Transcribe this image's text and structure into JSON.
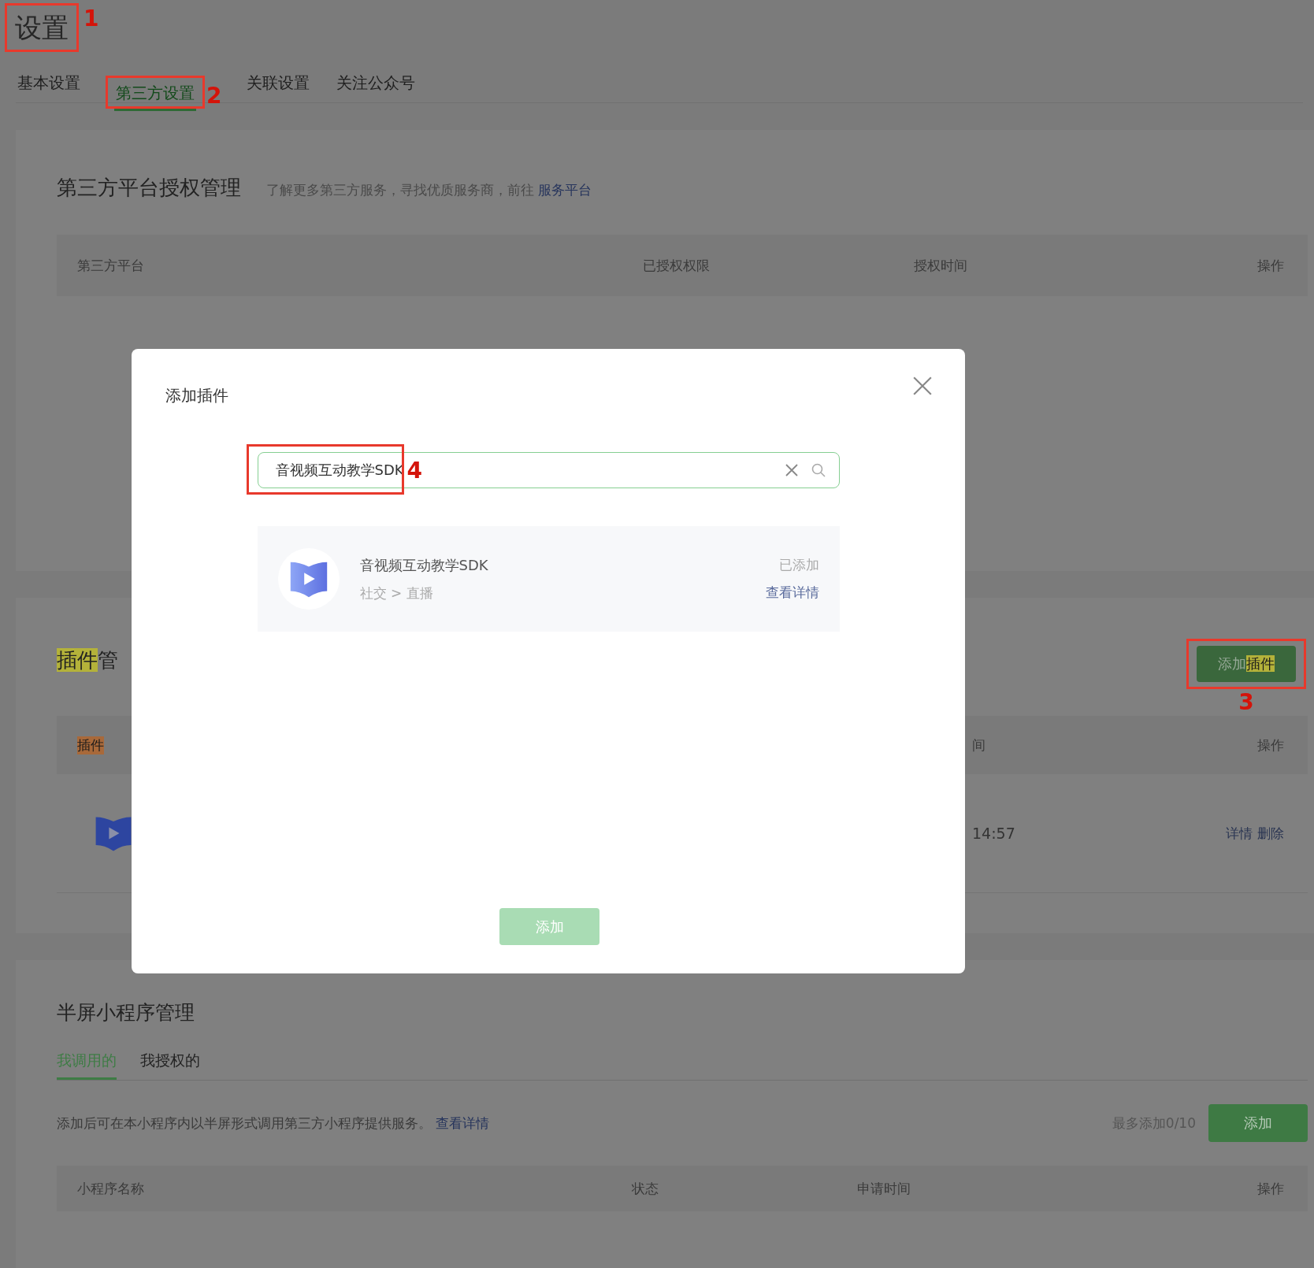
{
  "page_title": {
    "text": "设置",
    "marker": "1"
  },
  "tabs": [
    {
      "label": "基本设置",
      "selected": false
    },
    {
      "label": "第三方设置",
      "selected": true,
      "marker": "2"
    },
    {
      "label": "关联设置",
      "selected": false
    },
    {
      "label": "关注公众号",
      "selected": false
    }
  ],
  "platform_section": {
    "title": "第三方平台授权管理",
    "hint": "了解更多第三方服务，寻找优质服务商，前往",
    "link": "服务平台",
    "columns": [
      "第三方平台",
      "已授权权限",
      "授权时间",
      "操作"
    ]
  },
  "plugin_section": {
    "title": [
      {
        "text": "插件",
        "color": "#b4b23a"
      },
      {
        "text": "管"
      }
    ],
    "add_button": {
      "parts": [
        {
          "text": "添加"
        },
        {
          "text": "插件",
          "color": "#b4b23a"
        }
      ],
      "marker": "3"
    },
    "columns": [
      {
        "text": "插件",
        "color": "#a8693a"
      },
      {
        "text": "间"
      },
      {
        "text": "操作"
      }
    ],
    "rows": [
      {
        "time": "14:57",
        "actions": [
          "详情",
          "删除"
        ]
      }
    ]
  },
  "mini_program_section": {
    "title": "半屏小程序管理",
    "tabs": [
      {
        "label": "我调用的",
        "selected": true
      },
      {
        "label": "我授权的",
        "selected": false
      }
    ],
    "description": "添加后可在本小程序内以半屏形式调用第三方小程序提供服务。",
    "link": "查看详情",
    "limit": "最多添加0/10",
    "add_button": "添加",
    "columns": [
      "小程序名称",
      "状态",
      "申请时间",
      "操作"
    ]
  },
  "dialog": {
    "title": "添加插件",
    "search": {
      "value": "音视频互动教学SDK",
      "marker": "4"
    },
    "results": [
      {
        "name": "音视频互动教学SDK",
        "category": "社交 > 直播",
        "status": "已添加",
        "link": "查看详情"
      }
    ],
    "add_button": {
      "label": "添加",
      "disabled": true
    }
  }
}
